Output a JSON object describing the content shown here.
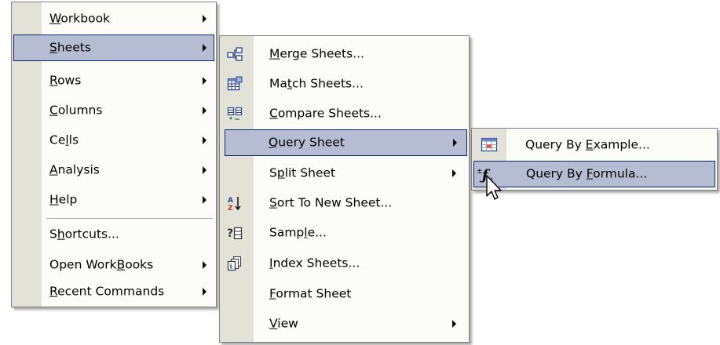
{
  "menu_main": {
    "items": [
      {
        "pre": "",
        "key": "W",
        "post": "orkbook",
        "submenu": true
      },
      {
        "pre": "",
        "key": "S",
        "post": "heets",
        "submenu": true
      },
      {
        "pre": "",
        "key": "R",
        "post": "ows",
        "submenu": true
      },
      {
        "pre": "",
        "key": "C",
        "post": "olumns",
        "submenu": true
      },
      {
        "pre": "Ce",
        "key": "l",
        "post": "ls",
        "submenu": true
      },
      {
        "pre": "",
        "key": "A",
        "post": "nalysis",
        "submenu": true
      },
      {
        "pre": "",
        "key": "H",
        "post": "elp",
        "submenu": true
      },
      {
        "pre": "S",
        "key": "h",
        "post": "ortcuts...",
        "submenu": false
      },
      {
        "pre": "Open Work",
        "key": "B",
        "post": "ooks",
        "submenu": true
      },
      {
        "pre": "",
        "key": "R",
        "post": "ecent Commands",
        "submenu": true
      }
    ]
  },
  "menu_sheets": {
    "items": [
      {
        "pre": "",
        "key": "M",
        "post": "erge Sheets...",
        "icon": "merge-sheets-icon"
      },
      {
        "pre": "Ma",
        "key": "t",
        "post": "ch Sheets...",
        "icon": "match-sheets-icon"
      },
      {
        "pre": "",
        "key": "C",
        "post": "ompare Sheets...",
        "icon": "compare-sheets-icon"
      },
      {
        "pre": "",
        "key": "Q",
        "post": "uery Sheet",
        "icon": ""
      },
      {
        "pre": "S",
        "key": "p",
        "post": "lit Sheet",
        "icon": ""
      },
      {
        "pre": "",
        "key": "S",
        "post": "ort To New Sheet...",
        "icon": "sort-az-icon"
      },
      {
        "pre": "Samp",
        "key": "l",
        "post": "e...",
        "icon": "sample-icon"
      },
      {
        "pre": "",
        "key": "I",
        "post": "ndex Sheets...",
        "icon": "index-sheets-icon"
      },
      {
        "pre": "",
        "key": "F",
        "post": "ormat Sheet",
        "icon": ""
      },
      {
        "pre": "",
        "key": "V",
        "post": "iew",
        "icon": ""
      }
    ]
  },
  "menu_query": {
    "items": [
      {
        "pre": "Query By ",
        "key": "E",
        "post": "xample...",
        "icon": "query-by-example-icon"
      },
      {
        "pre": "Query By ",
        "key": "F",
        "post": "ormula...",
        "icon": "query-by-formula-icon"
      }
    ]
  },
  "colors": {
    "selection_fill": "#b6bdd2",
    "selection_border": "#0a246a",
    "gutter": "#e3e2d9",
    "menu_bg": "#fcfcf9"
  }
}
